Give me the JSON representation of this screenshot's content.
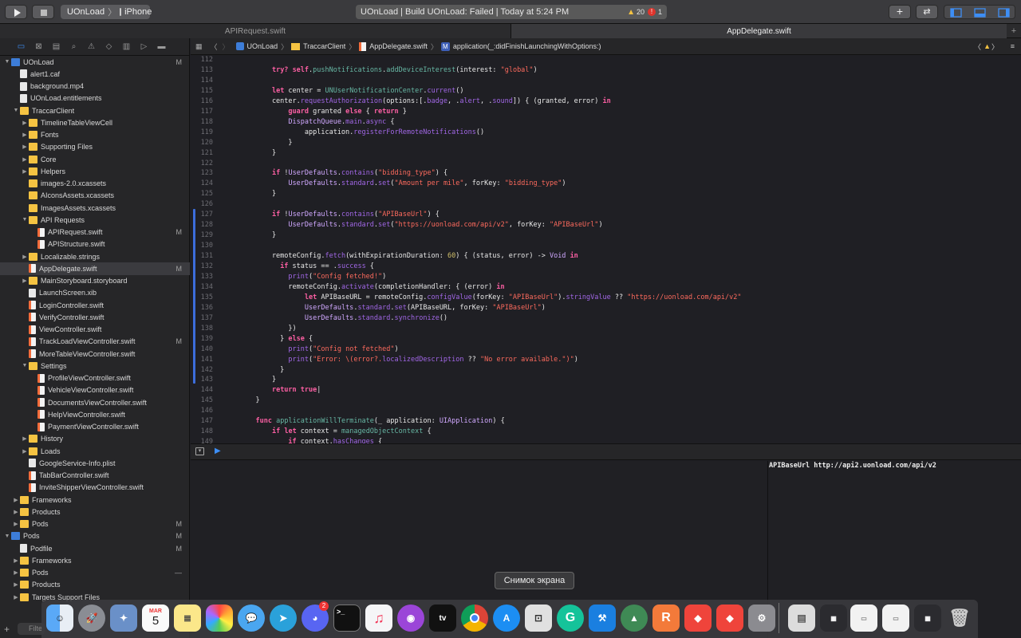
{
  "toolbar": {
    "scheme": "UOnLoad",
    "device": "iPhone",
    "status": "UOnLoad | Build UOnLoad: Failed | Today at 5:24 PM",
    "warnings": "20",
    "errors": "1"
  },
  "tabs": [
    "APIRequest.swift",
    "AppDelegate.swift"
  ],
  "jumpbar": [
    "UOnLoad",
    "TraccarClient",
    "AppDelegate.swift",
    "application(_:didFinishLaunchingWithOptions:)"
  ],
  "tree": [
    {
      "label": "UOnLoad",
      "indent": 0,
      "kind": "proj",
      "open": true,
      "badge": "M"
    },
    {
      "label": "alert1.caf",
      "indent": 1,
      "kind": "file"
    },
    {
      "label": "background.mp4",
      "indent": 1,
      "kind": "file"
    },
    {
      "label": "UOnLoad.entitlements",
      "indent": 1,
      "kind": "file"
    },
    {
      "label": "TraccarClient",
      "indent": 1,
      "kind": "fold",
      "open": true
    },
    {
      "label": "TimelineTableViewCell",
      "indent": 2,
      "kind": "fold",
      "closed": true
    },
    {
      "label": "Fonts",
      "indent": 2,
      "kind": "fold",
      "closed": true
    },
    {
      "label": "Supporting Files",
      "indent": 2,
      "kind": "fold",
      "closed": true
    },
    {
      "label": "Core",
      "indent": 2,
      "kind": "fold",
      "closed": true
    },
    {
      "label": "Helpers",
      "indent": 2,
      "kind": "fold",
      "closed": true
    },
    {
      "label": "images-2.0.xcassets",
      "indent": 2,
      "kind": "fold"
    },
    {
      "label": "AIconsAssets.xcassets",
      "indent": 2,
      "kind": "fold"
    },
    {
      "label": "ImagesAssets.xcassets",
      "indent": 2,
      "kind": "fold"
    },
    {
      "label": "API Requests",
      "indent": 2,
      "kind": "fold",
      "open": true
    },
    {
      "label": "APIRequest.swift",
      "indent": 3,
      "kind": "swift",
      "badge": "M"
    },
    {
      "label": "APIStructure.swift",
      "indent": 3,
      "kind": "swift"
    },
    {
      "label": "Localizable.strings",
      "indent": 2,
      "kind": "fold",
      "closed": true
    },
    {
      "label": "AppDelegate.swift",
      "indent": 2,
      "kind": "swift",
      "badge": "M",
      "selected": true
    },
    {
      "label": "MainStoryboard.storyboard",
      "indent": 2,
      "kind": "fold",
      "closed": true
    },
    {
      "label": "LaunchScreen.xib",
      "indent": 2,
      "kind": "file"
    },
    {
      "label": "LoginController.swift",
      "indent": 2,
      "kind": "swift"
    },
    {
      "label": "VerifyController.swift",
      "indent": 2,
      "kind": "swift"
    },
    {
      "label": "ViewController.swift",
      "indent": 2,
      "kind": "swift"
    },
    {
      "label": "TrackLoadViewController.swift",
      "indent": 2,
      "kind": "swift",
      "badge": "M"
    },
    {
      "label": "MoreTableViewController.swift",
      "indent": 2,
      "kind": "swift"
    },
    {
      "label": "Settings",
      "indent": 2,
      "kind": "fold",
      "open": true
    },
    {
      "label": "ProfileViewController.swift",
      "indent": 3,
      "kind": "swift"
    },
    {
      "label": "VehicleViewController.swift",
      "indent": 3,
      "kind": "swift"
    },
    {
      "label": "DocumentsViewController.swift",
      "indent": 3,
      "kind": "swift"
    },
    {
      "label": "HelpViewController.swift",
      "indent": 3,
      "kind": "swift"
    },
    {
      "label": "PaymentViewController.swift",
      "indent": 3,
      "kind": "swift"
    },
    {
      "label": "History",
      "indent": 2,
      "kind": "fold",
      "closed": true
    },
    {
      "label": "Loads",
      "indent": 2,
      "kind": "fold",
      "closed": true
    },
    {
      "label": "GoogleService-Info.plist",
      "indent": 2,
      "kind": "file"
    },
    {
      "label": "TabBarController.swift",
      "indent": 2,
      "kind": "swift"
    },
    {
      "label": "InviteShipperViewController.swift",
      "indent": 2,
      "kind": "swift"
    },
    {
      "label": "Frameworks",
      "indent": 1,
      "kind": "fold",
      "closed": true
    },
    {
      "label": "Products",
      "indent": 1,
      "kind": "fold",
      "closed": true
    },
    {
      "label": "Pods",
      "indent": 1,
      "kind": "fold",
      "closed": true,
      "badge": "M"
    },
    {
      "label": "Pods",
      "indent": 0,
      "kind": "proj",
      "open": true,
      "badge": "M"
    },
    {
      "label": "Podfile",
      "indent": 1,
      "kind": "file",
      "badge": "M"
    },
    {
      "label": "Frameworks",
      "indent": 1,
      "kind": "fold",
      "closed": true
    },
    {
      "label": "Pods",
      "indent": 1,
      "kind": "fold",
      "closed": true,
      "badge": "—"
    },
    {
      "label": "Products",
      "indent": 1,
      "kind": "fold",
      "closed": true
    },
    {
      "label": "Targets Support Files",
      "indent": 1,
      "kind": "fold",
      "closed": true
    }
  ],
  "code": [
    {
      "n": "112",
      "t": ""
    },
    {
      "n": "113",
      "t": "        <k>try?</k> <k>self</k>.<f>pushNotifications</f>.<f>addDeviceInterest</f>(interest: <s>\"global\"</s>)"
    },
    {
      "n": "114",
      "t": ""
    },
    {
      "n": "115",
      "t": "        <k>let</k> center = <f>UNUserNotificationCenter</f>.<p>current</p>()"
    },
    {
      "n": "116",
      "t": "        center.<p>requestAuthorization</p>(options:[.<p>badge</p>, .<p>alert</p>, .<p>sound</p>]) { (granted, error) <k>in</k>"
    },
    {
      "n": "117",
      "t": "            <k>guard</k> granted <k>else</k> { <k>return</k> }"
    },
    {
      "n": "118",
      "t": "            <y>DispatchQueue</y>.<p>main</p>.<p>async</p> {"
    },
    {
      "n": "119",
      "t": "                application.<p>registerForRemoteNotifications</p>()"
    },
    {
      "n": "120",
      "t": "            }"
    },
    {
      "n": "121",
      "t": "        }"
    },
    {
      "n": "122",
      "t": ""
    },
    {
      "n": "123",
      "t": "        <k>if</k> !<y>UserDefaults</y>.<p>contains</p>(<s>\"bidding_type\"</s>) {"
    },
    {
      "n": "124",
      "t": "            <y>UserDefaults</y>.<p>standard</p>.<p>set</p>(<s>\"Amount per mile\"</s>, forKey: <s>\"bidding_type\"</s>)"
    },
    {
      "n": "125",
      "t": "        }"
    },
    {
      "n": "126",
      "t": ""
    },
    {
      "n": "127",
      "t": "        <k>if</k> !<y>UserDefaults</y>.<p>contains</p>(<s>\"APIBaseUrl\"</s>) {"
    },
    {
      "n": "128",
      "t": "            <y>UserDefaults</y>.<p>standard</p>.<p>set</p>(<s>\"https://uonload.com/api/v2\"</s>, forKey: <s>\"APIBaseUrl\"</s>)"
    },
    {
      "n": "129",
      "t": "        }"
    },
    {
      "n": "130",
      "t": ""
    },
    {
      "n": "131",
      "t": "        remoteConfig.<p>fetch</p>(withExpirationDuration: <n>60</n>) { (status, error) -> <y>Void</y> <k>in</k>"
    },
    {
      "n": "132",
      "t": "          <k>if</k> status == .<p>success</p> {"
    },
    {
      "n": "133",
      "t": "            <p>print</p>(<s>\"Config fetched!\"</s>)"
    },
    {
      "n": "134",
      "t": "            remoteConfig.<p>activate</p>(completionHandler: { (error) <k>in</k>"
    },
    {
      "n": "135",
      "t": "                <k>let</k> APIBaseURL = remoteConfig.<p>configValue</p>(forKey: <s>\"APIBaseUrl\"</s>).<p>stringValue</p> ?? <s>\"https://uonload.com/api/v2\"</s>"
    },
    {
      "n": "136",
      "t": "                <y>UserDefaults</y>.<p>standard</p>.<p>set</p>(APIBaseURL, forKey: <s>\"APIBaseUrl\"</s>)"
    },
    {
      "n": "137",
      "t": "                <y>UserDefaults</y>.<p>standard</p>.<p>synchronize</p>()"
    },
    {
      "n": "138",
      "t": "            })"
    },
    {
      "n": "139",
      "t": "          } <k>else</k> {"
    },
    {
      "n": "140",
      "t": "            <p>print</p>(<s>\"Config not fetched\"</s>)"
    },
    {
      "n": "141",
      "t": "            <p>print</p>(<s>\"Error: \\(error?.</s><p>localizedDescription</p> ?? <s>\"No error available.\")\"</s>)"
    },
    {
      "n": "142",
      "t": "          }"
    },
    {
      "n": "143",
      "t": "        }"
    },
    {
      "n": "144",
      "t": "        <k>return</k> <k>true</k>|"
    },
    {
      "n": "145",
      "t": "    }"
    },
    {
      "n": "146",
      "t": ""
    },
    {
      "n": "147",
      "t": "    <k>func</k> <f>applicationWillTerminate</f>(_ application: <y>UIApplication</y>) {"
    },
    {
      "n": "148",
      "t": "        <k>if</k> <k>let</k> context = <f>managedObjectContext</f> {"
    },
    {
      "n": "149",
      "t": "            <k>if</k> context.<p>hasChanges</p> {"
    }
  ],
  "console_output": "APIBaseUrl http://api2.uonload.com/api/v2",
  "tooltip": "Снимок экрана",
  "filter_placeholder": "Filte",
  "calendar": {
    "month": "MAR",
    "day": "5"
  },
  "discord_badge": "2",
  "dock_apps": [
    "Finder",
    "Launchpad",
    "Preview",
    "Calendar",
    "Notes",
    "Photos",
    "Messages",
    "Telegram",
    "Discord",
    "Terminal",
    "Music",
    "Podcasts",
    "TV",
    "Chrome",
    "App Store",
    "Screenshot",
    "Grammarly",
    "Xcode",
    "Android Studio",
    "RubyMine",
    "AnyDesk",
    "AnyDesk",
    "System Preferences",
    "Downloads",
    "Recent 1",
    "Recent 2",
    "Recent 3",
    "Recent 4",
    "Trash"
  ]
}
